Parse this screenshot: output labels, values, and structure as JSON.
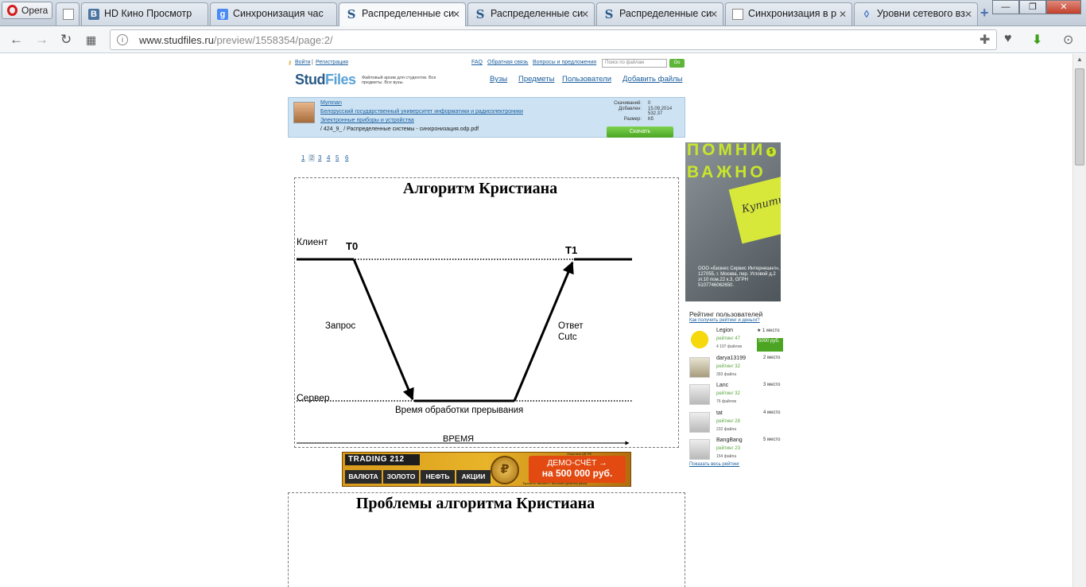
{
  "browser": {
    "opera_label": "Opera",
    "tabs": [
      {
        "label": ""
      },
      {
        "label": "HD Кино Просмотр"
      },
      {
        "label": "Синхронизация час"
      },
      {
        "label": "Распределенные си"
      },
      {
        "label": "Распределенные си"
      },
      {
        "label": "Распределенные си"
      },
      {
        "label": "Синхронизация в р"
      },
      {
        "label": "Уровни сетевого вз"
      }
    ],
    "address_host": "www.studfiles.ru",
    "address_path": "/preview/1558354/page:2/"
  },
  "site": {
    "login": "Войти",
    "register": "Регистрация",
    "faq": "FAQ",
    "feedback": "Обратная связь",
    "suggestions": "Вопросы и предложения",
    "search_placeholder": "Поиск по файлам",
    "search_go": "Go",
    "logo_a": "Stud",
    "logo_b": "Files",
    "tagline": "Файловый архив для студентов. Все предметы. Все вузы.",
    "menu": [
      "Вузы",
      "Предметы",
      "Пользователи",
      "Добавить файлы"
    ]
  },
  "file_info": {
    "user": "Mymnan",
    "university": "Белорусский государственный университет информатики и радиоэлектроники",
    "subject": "Электронные приборы и устройства",
    "path": "/ 424_9_ / Распределенные системы - синхронизация.odp.pdf",
    "stats": [
      {
        "label": "Скачиваний:",
        "value": "0"
      },
      {
        "label": "Добавлен:",
        "value": "15.09.2014"
      },
      {
        "label": "",
        "value": "532.37"
      },
      {
        "label": "Размер:",
        "value": "Кб"
      }
    ],
    "download": "Скачать"
  },
  "pager": [
    "1",
    "2",
    "3",
    "4",
    "5",
    "6"
  ],
  "slide1": {
    "title": "Алгоритм Кристиана",
    "client": "Клиент",
    "server": "Сервер",
    "t0": "T0",
    "t1": "T1",
    "request": "Запрос",
    "reply_1": "Ответ",
    "reply_2": "Cutc",
    "processing": "Время обработки прерывания",
    "time": "ВРЕМЯ"
  },
  "slide2": {
    "title": "Проблемы алгоритма Кристиана"
  },
  "ad_right": {
    "big1": "ПОМНИ",
    "big2": "ВАЖНО",
    "note": "Купить биле-",
    "info": "ООО «Бизнес Сервис Интернешнл», 127055, г. Москва, пер. Угловой д.2 эт.10 пом.22 к.3, ОГРН 5107746062650."
  },
  "rating": {
    "title": "Рейтинг пользователей",
    "subtitle": "Как получить рейтинг и деньги?",
    "show_all": "Показать весь рейтинг",
    "users": [
      {
        "name": "Legion",
        "score": "рейтинг 47",
        "files": "4 197 файлов",
        "place": "★ 1 место",
        "badge": "5000 руб."
      },
      {
        "name": "darya13199",
        "score": "рейтинг 32",
        "files": "393 файла",
        "place": "2 место",
        "badge": ""
      },
      {
        "name": "Lanc",
        "score": "рейтинг 32",
        "files": "76 файлов",
        "place": "3 место",
        "badge": ""
      },
      {
        "name": "tat",
        "score": "рейтинг 28",
        "files": "232 файла",
        "place": "4 место",
        "badge": ""
      },
      {
        "name": "BangBang",
        "score": "рейтинг 23",
        "files": "154 файла",
        "place": "5 место",
        "badge": ""
      }
    ]
  },
  "banner": {
    "logo": "TRADING 212",
    "buttons": [
      "ВАЛЮТА",
      "ЗОЛОТО",
      "НЕФТЬ",
      "АКЦИИ"
    ],
    "demo_1": "ДЕМО-СЧЁТ →",
    "demo_2": "на 500 000 руб.",
    "top_note": "Лицензия ЦБ РФ",
    "bottom_note": "Торговля связана с высоким уровнем риска"
  },
  "colors": {
    "link": "#1b5e9d",
    "green": "#4ba523",
    "info_bg": "#cde3f4"
  }
}
